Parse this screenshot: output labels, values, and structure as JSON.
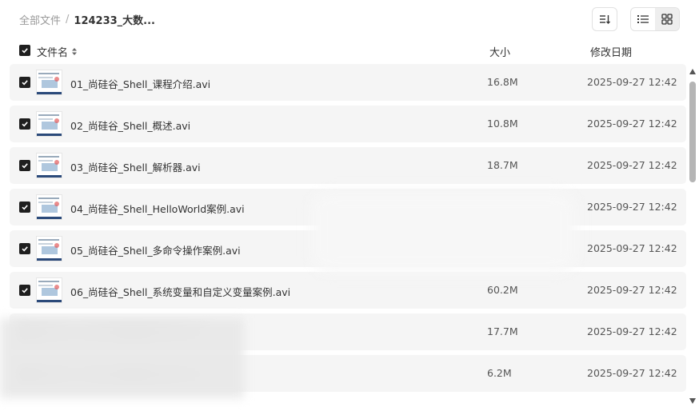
{
  "breadcrumb": {
    "root": "全部文件",
    "separator": "/",
    "current": "124233_大数..."
  },
  "toolbar": {
    "sort_icon": "sort-icon",
    "list_view_icon": "list-view-icon",
    "grid_view_icon": "grid-view-icon",
    "active_view": "list"
  },
  "columns": {
    "name": "文件名",
    "size": "大小",
    "date": "修改日期"
  },
  "files": [
    {
      "name": "01_尚硅谷_Shell_课程介绍.avi",
      "size": "16.8M",
      "date": "2025-09-27 12:42",
      "checked": true
    },
    {
      "name": "02_尚硅谷_Shell_概述.avi",
      "size": "10.8M",
      "date": "2025-09-27 12:42",
      "checked": true
    },
    {
      "name": "03_尚硅谷_Shell_解析器.avi",
      "size": "18.7M",
      "date": "2025-09-27 12:42",
      "checked": true
    },
    {
      "name": "04_尚硅谷_Shell_HelloWorld案例.avi",
      "size": "",
      "date": "2025-09-27 12:42",
      "checked": true
    },
    {
      "name": "05_尚硅谷_Shell_多命令操作案例.avi",
      "size": "",
      "date": "2025-09-27 12:42",
      "checked": true
    },
    {
      "name": "06_尚硅谷_Shell_系统变量和自定义变量案例.avi",
      "size": "60.2M",
      "date": "2025-09-27 12:42",
      "checked": true
    },
    {
      "name": "",
      "size": "17.7M",
      "date": "2025-09-27 12:42",
      "checked": false
    },
    {
      "name": "",
      "size": "6.2M",
      "date": "2025-09-27 12:42",
      "checked": false
    }
  ],
  "colors": {
    "row_bg": "#f5f5f5",
    "checkbox": "#1f1f1f",
    "scroll_thumb": "#b5b5b5"
  }
}
